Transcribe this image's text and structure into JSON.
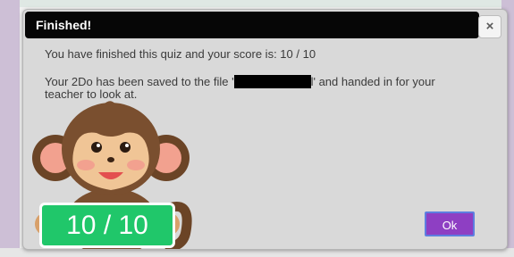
{
  "dialog": {
    "title": "Finished!",
    "close_glyph": "×",
    "score_message": "You have finished this quiz and your score is: 10 / 10",
    "saved_before": "Your 2Do has been saved to the file '",
    "saved_after": "l' and handed in for your teacher to look at.",
    "score_badge": "10 / 10",
    "ok_label": "Ok",
    "mascot": "monkey",
    "colors": {
      "title_bar": "#060606",
      "ok_button": "#8e3fc3",
      "score_badge": "#20c76a",
      "dialog_bg": "#d9d9d9"
    }
  }
}
